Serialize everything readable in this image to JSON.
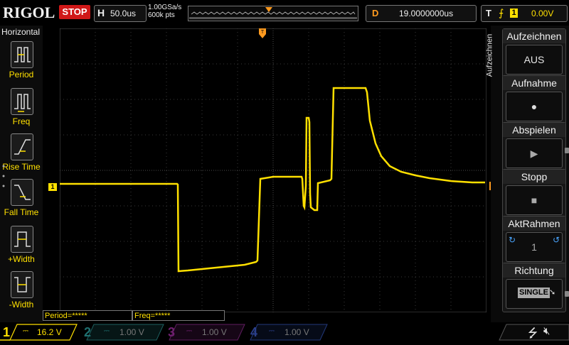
{
  "brand": "RIGOL",
  "run_state": "STOP",
  "timebase": {
    "label": "H",
    "value": "50.0us"
  },
  "sample": {
    "rate": "1.00GSa/s",
    "depth": "600k pts"
  },
  "delay": {
    "label": "D",
    "value": "19.0000000us"
  },
  "trigger": {
    "label": "T",
    "edge_icon": "rising-edge-icon",
    "channel": "1",
    "level": "0.00V"
  },
  "markers": {
    "trigger_pos": "T",
    "ch1_level": "1",
    "trigger_level": "T"
  },
  "left_panel": {
    "title": "Horizontal",
    "items": [
      {
        "label": "Period",
        "icon": "period-icon"
      },
      {
        "label": "Freq",
        "icon": "freq-icon"
      },
      {
        "label": "Rise Time",
        "icon": "rise-time-icon"
      },
      {
        "label": "Fall Time",
        "icon": "fall-time-icon"
      },
      {
        "label": "+Width",
        "icon": "pos-width-icon"
      },
      {
        "label": "-Width",
        "icon": "neg-width-icon"
      }
    ]
  },
  "right_panel": {
    "tab": "Aufzeichnen",
    "menu": [
      {
        "title": "Aufzeichnen",
        "value": "AUS"
      },
      {
        "title": "Aufnahme",
        "value": "●"
      },
      {
        "title": "Abspielen",
        "value": "▶"
      },
      {
        "title": "Stopp",
        "value": "■"
      },
      {
        "title": "AktRahmen",
        "value": "1"
      },
      {
        "title": "Richtung",
        "value": "SINGLE"
      }
    ]
  },
  "measurements": [
    {
      "text": "Period=*****"
    },
    {
      "text": "Freq=*****"
    }
  ],
  "channels": [
    {
      "num": "1",
      "scale": "16.2 V",
      "color": "#ffe000",
      "active": true
    },
    {
      "num": "2",
      "scale": "1.00 V",
      "color": "#00c8c8",
      "active": false
    },
    {
      "num": "3",
      "scale": "1.00 V",
      "color": "#ff00ff",
      "active": false
    },
    {
      "num": "4",
      "scale": "1.00 V",
      "color": "#2a6bff",
      "active": false
    }
  ],
  "colors": {
    "trace": "#ffe000",
    "accent_orange": "#ff9a1f",
    "stop_red": "#d01818"
  },
  "status_icons": [
    "usb-icon",
    "speaker-mute-icon"
  ]
}
